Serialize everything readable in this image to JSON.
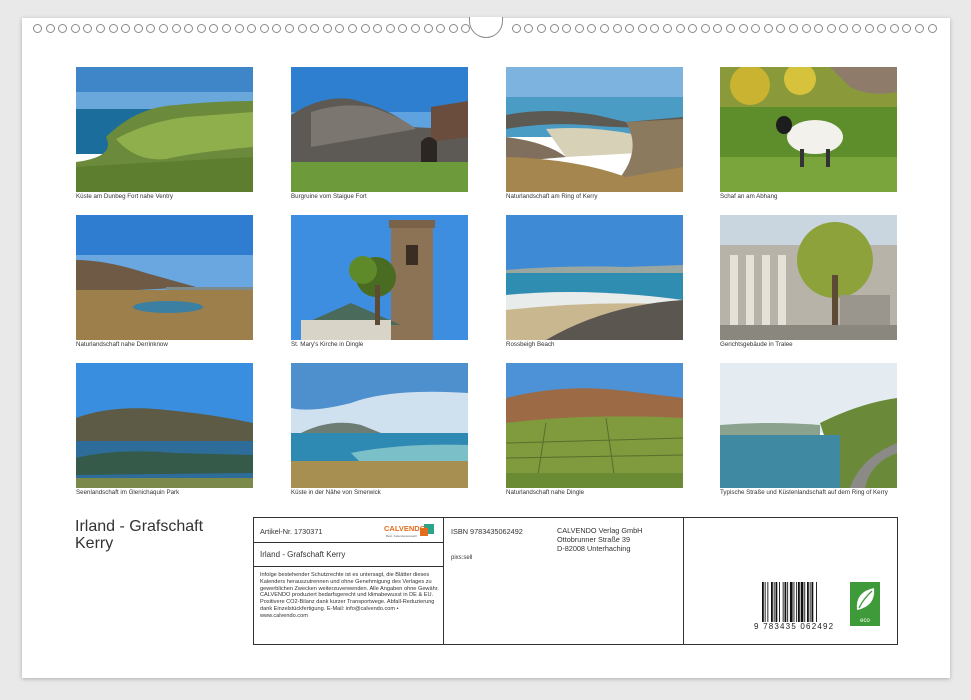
{
  "calendar": {
    "title": "Irland - Grafschaft Kerry",
    "title_line1": "Irland - Grafschaft",
    "title_line2": "Kerry"
  },
  "photos": [
    {
      "caption": "Küste am Dunbeg Fort nahe Ventry"
    },
    {
      "caption": "Burgruine vom Staigue Fort"
    },
    {
      "caption": "Naturlandschaft am Ring of Kerry"
    },
    {
      "caption": "Schaf an am Abhang"
    },
    {
      "caption": "Naturlandschaft nahe Derrinknow"
    },
    {
      "caption": "St. Mary's Kirche in Dingle"
    },
    {
      "caption": "Rossbeigh Beach"
    },
    {
      "caption": "Gerichtsgebäude in Tralee"
    },
    {
      "caption": "Seenlandschaft im Glenichaquin Park"
    },
    {
      "caption": "Küste in der Nähe von Smerwick"
    },
    {
      "caption": "Naturlandschaft nahe Dingle"
    },
    {
      "caption": "Typische Straße und Küstenlandschaft auf dem Ring of Kerry"
    }
  ],
  "info": {
    "article_number": "Artikel-Nr. 1730371",
    "product_title": "Irland - Grafschaft Kerry",
    "logo_name": "CALVENDO",
    "logo_tagline": "Best. Kalenderauswahl",
    "legal_text": "Infolge bestehender Schutzrechte ist es untersagt, die Blätter dieses Kalenders herauszutrennen und ohne Genehmigung des Verlages zu gewerblichen Zwecken weiterzuverwenden. Alle Angaben ohne Gewähr. CALVENDO produziert bedarfsgerecht und klimabewusst in DE & EU. Positivere CO2-Bilanz dank kurzer Transportwege. Abfall-Reduzierung dank Einzelstückfertigung. E-Mail: info@calvendo.com • www.calvendo.com",
    "isbn": "ISBN 9783435062492",
    "author": "pixs:sell",
    "publisher_line1": "CALVENDO Verlag GmbH",
    "publisher_line2": "Ottobrunner Straße 39",
    "publisher_line3": "D-82008 Unterhaching",
    "barcode_digits": "9 783435 062492",
    "eco_label": "eco"
  }
}
